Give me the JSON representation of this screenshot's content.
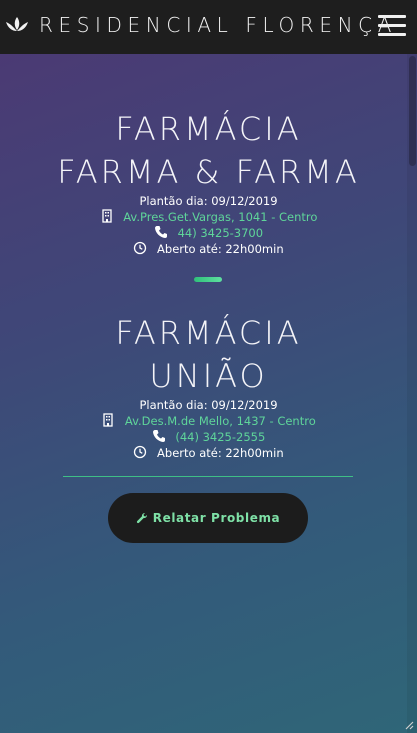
{
  "header": {
    "brand": "RESIDENCIAL FLORENÇA",
    "logo_icon": "lotus-icon",
    "menu_icon": "hamburger-menu-icon"
  },
  "pharmacies": [
    {
      "name_line1": "FARMÁCIA",
      "name_line2": "FARMA & FARMA",
      "duty_day": "Plantão dia: 09/12/2019",
      "address": "Av.Pres.Get.Vargas, 1041 - Centro",
      "phone": "44) 3425-3700",
      "hours": "Aberto até: 22h00min"
    },
    {
      "name_line1": "FARMÁCIA",
      "name_line2": "UNIÃO",
      "duty_day": "Plantão dia: 09/12/2019",
      "address": "Av.Des.M.de Mello, 1437 - Centro",
      "phone": "(44) 3425-2555",
      "hours": "Aberto até: 22h00min"
    }
  ],
  "report_button": {
    "label": "Relatar Problema",
    "icon": "wrench-icon"
  },
  "colors": {
    "accent": "#5fd59a",
    "header_bg": "#1e1e1e",
    "button_bg": "#1c1c1c"
  }
}
